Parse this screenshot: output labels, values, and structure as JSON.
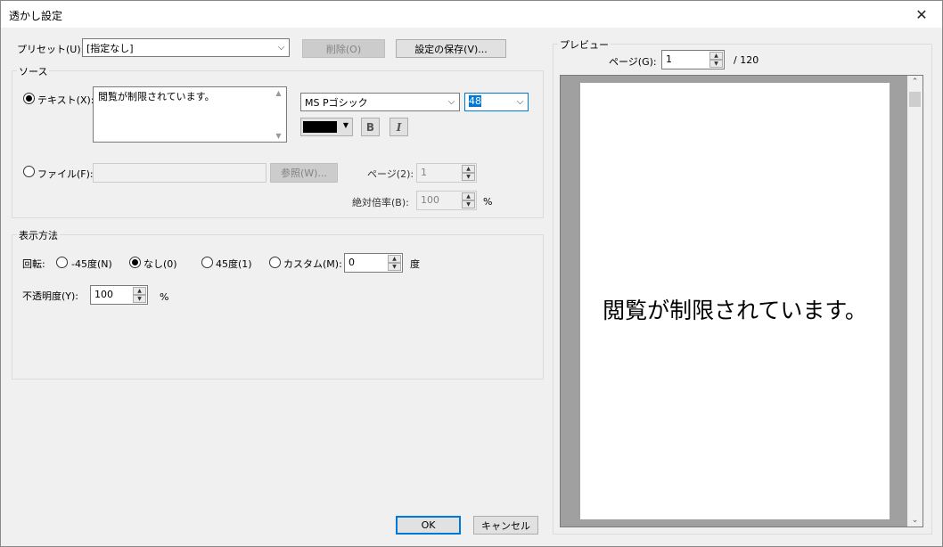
{
  "window": {
    "title": "透かし設定",
    "close_glyph": "✕"
  },
  "preset": {
    "label": "プリセット(U):",
    "value": "[指定なし]",
    "delete_label": "削除(O)",
    "save_label": "設定の保存(V)..."
  },
  "source": {
    "group_title": "ソース",
    "text_radio_label": "テキスト(X):",
    "text_value": "閲覧が制限されています。",
    "font_name": "MS Pゴシック",
    "font_size": "48",
    "bold_label": "B",
    "italic_label": "I",
    "color": "#000000",
    "file_radio_label": "ファイル(F):",
    "browse_label": "参照(W)...",
    "page_label": "ページ(2):",
    "page_value": "1",
    "scale_label": "絶対倍率(B):",
    "scale_value": "100",
    "scale_unit": "%"
  },
  "display": {
    "group_title": "表示方法",
    "rotation_label": "回転:",
    "rot_minus45": "-45度(N)",
    "rot_none": "なし(0)",
    "rot_45": "45度(1)",
    "rot_custom": "カスタム(M):",
    "custom_value": "0",
    "custom_unit": "度",
    "opacity_label": "不透明度(Y):",
    "opacity_value": "100",
    "opacity_unit": "%"
  },
  "preview": {
    "group_title": "プレビュー",
    "page_label": "ページ(G):",
    "page_value": "1",
    "page_total": "/  120",
    "watermark_text": "閲覧が制限されています。"
  },
  "footer": {
    "ok_label": "OK",
    "cancel_label": "キャンセル"
  }
}
